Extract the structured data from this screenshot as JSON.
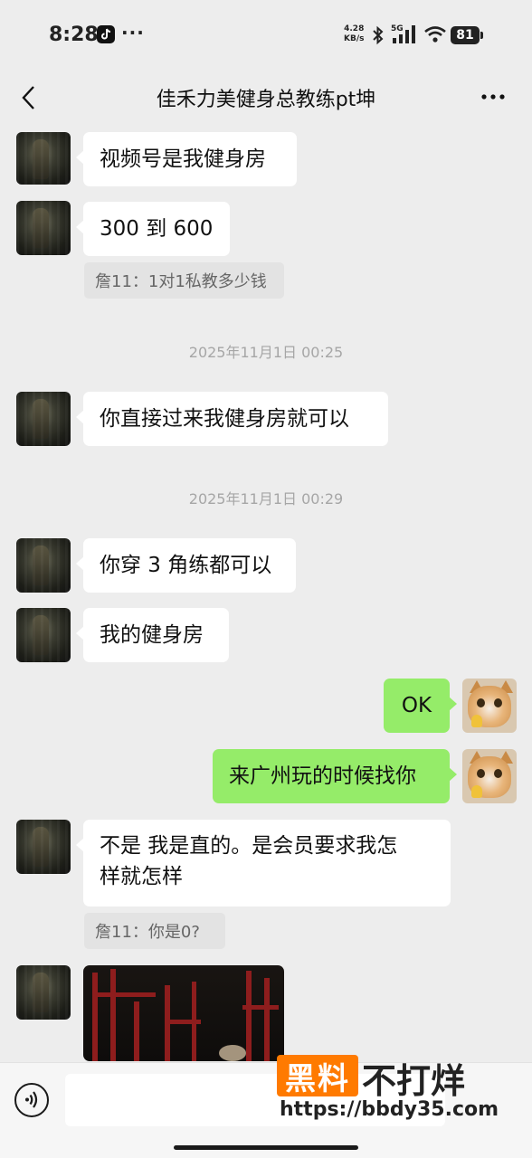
{
  "status_bar": {
    "time": "8:28",
    "more_dots": "···",
    "net_speed_value": "4.28",
    "net_speed_unit": "KB/s",
    "network_type": "5G",
    "battery": "81"
  },
  "header": {
    "title": "佳禾力美健身总教练pt坤"
  },
  "messages": [
    {
      "side": "left",
      "text": "视频号是我健身房"
    },
    {
      "side": "left",
      "text": "300 到 600"
    },
    {
      "type": "quote",
      "text": "詹11：1对1私教多少钱"
    },
    {
      "type": "time",
      "text": "2025年11月1日 00:25"
    },
    {
      "side": "left",
      "text": "你直接过来我健身房就可以"
    },
    {
      "type": "time",
      "text": "2025年11月1日 00:29"
    },
    {
      "side": "left",
      "text": "你穿 3 角练都可以"
    },
    {
      "side": "left",
      "text": "我的健身房"
    },
    {
      "side": "right",
      "text": "OK"
    },
    {
      "side": "right",
      "text": "来广州玩的时候找你"
    },
    {
      "side": "left",
      "text_line1": "不是 我是直的。是会员要求我怎",
      "text_line2": "样就怎样"
    },
    {
      "type": "quote",
      "text": "詹11：你是0?"
    },
    {
      "side": "left",
      "type": "image"
    }
  ],
  "input_bar": {
    "placeholder": ""
  },
  "watermark": {
    "logo": "黑料",
    "text": "不打烊",
    "url": "https://bbdy35.com"
  },
  "colors": {
    "background": "#ededed",
    "my_bubble": "#95ec69",
    "their_bubble": "#ffffff",
    "watermark_accent": "#ff7a00"
  }
}
